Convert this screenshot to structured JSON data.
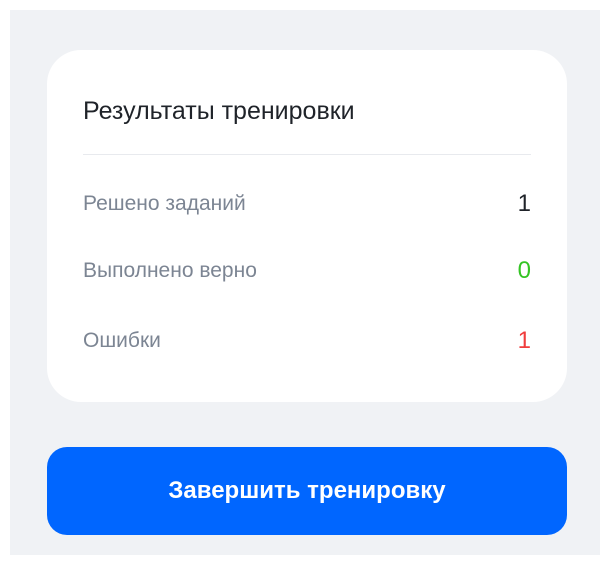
{
  "card": {
    "title": "Результаты тренировки",
    "stats": [
      {
        "label": "Решено заданий",
        "value": "1",
        "color": "#1f2329"
      },
      {
        "label": "Выполнено верно",
        "value": "0",
        "color": "#34c424"
      },
      {
        "label": "Ошибки",
        "value": "1",
        "color": "#f03d3d"
      }
    ]
  },
  "actions": {
    "finish_label": "Завершить тренировку",
    "finish_color": "#0066ff"
  }
}
